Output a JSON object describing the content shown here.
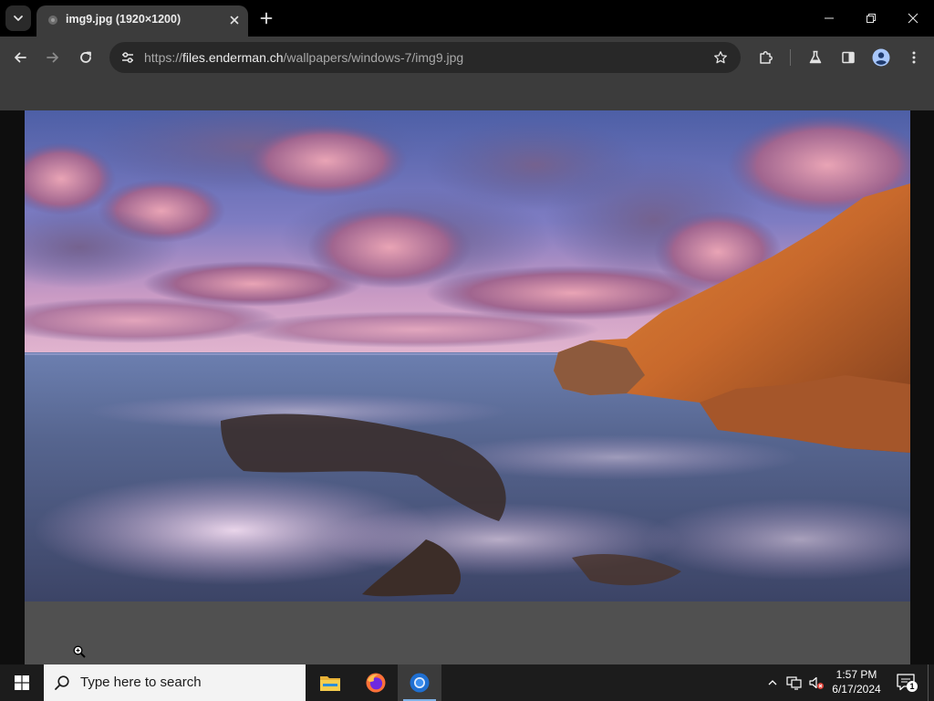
{
  "browser": {
    "tab": {
      "title": "img9.jpg (1920×1200)"
    },
    "address": {
      "scheme": "https://",
      "host": "files.enderman.ch",
      "path": "/wallpapers/windows-7/img9.jpg"
    },
    "icons": {
      "tab_search": "chevron-down-icon",
      "tab_close": "close-icon",
      "new_tab": "plus-icon",
      "minimize": "minimize-icon",
      "maximize": "restore-icon",
      "close": "close-icon",
      "back": "arrow-left-icon",
      "forward": "arrow-right-icon",
      "reload": "reload-icon",
      "site_info": "tune-icon",
      "bookmark": "star-icon",
      "extensions": "puzzle-icon",
      "labs": "flask-icon",
      "side_panel": "side-panel-icon",
      "profile": "avatar-icon",
      "menu": "kebab-menu-icon"
    }
  },
  "colors": {
    "titlebar": "#000000",
    "toolbar": "#3c3c3c",
    "omnibox": "#282828",
    "viewer_bg": "#0e0e0e",
    "image_frame": "#505050",
    "taskbar": "#1c1c1c",
    "accent": "#7fb2e6"
  },
  "taskbar": {
    "search_placeholder": "Type here to search",
    "apps": [
      {
        "name": "File Explorer",
        "icon": "folder-icon",
        "active": false
      },
      {
        "name": "Firefox",
        "icon": "firefox-icon",
        "active": false
      },
      {
        "name": "Chromium",
        "icon": "chromium-icon",
        "active": true
      }
    ],
    "tray_icons": [
      "chevron-up-icon",
      "network-icon",
      "volume-muted-icon"
    ],
    "time": "1:57 PM",
    "date": "6/17/2024",
    "notification_count": "1"
  }
}
